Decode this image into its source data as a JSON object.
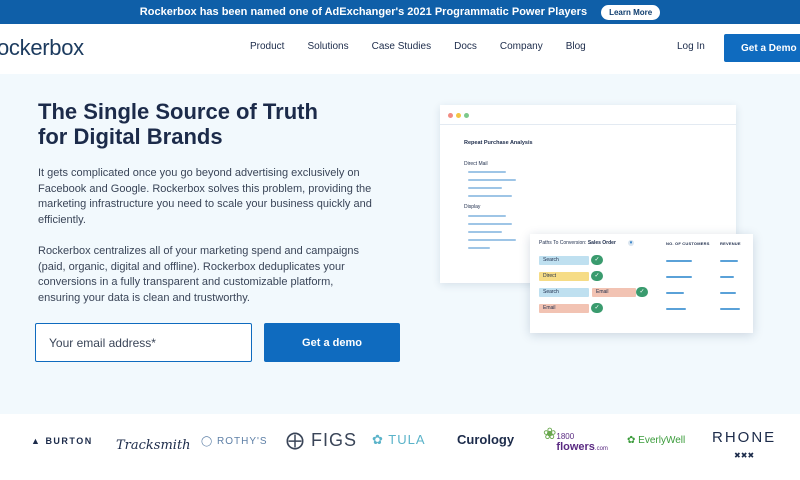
{
  "announcement": {
    "text": "Rockerbox has been named one of AdExchanger's 2021 Programmatic Power Players",
    "button": "Learn More"
  },
  "nav": {
    "logo": "ockerbox",
    "links": [
      "Product",
      "Solutions",
      "Case Studies",
      "Docs",
      "Company",
      "Blog"
    ],
    "login": "Log In",
    "cta": "Get a Demo"
  },
  "hero": {
    "headline_line1": "The Single Source of Truth",
    "headline_line2": "for Digital Brands",
    "paragraph1": "It gets complicated once you go beyond advertising exclusively on Facebook and Google. Rockerbox solves this problem, providing the marketing infrastructure you need to scale your business quickly and efficiently.",
    "paragraph2": "Rockerbox centralizes all of your marketing spend and campaigns (paid, organic, digital and offline). Rockerbox deduplicates your conversions in a fully transparent and customizable platform, ensuring your data is clean and trustworthy.",
    "email_placeholder": "Your email address*",
    "cta": "Get a demo"
  },
  "mockup": {
    "title": "Repeat Purchase Analysis",
    "label_direct_mail": "Direct Mail",
    "label_display": "Display",
    "panel": {
      "heading_prefix": "Paths To Conversion:",
      "heading_value": "Sales Order",
      "col_customers": "NO. OF CUSTOMERS",
      "col_revenue": "REVENUE",
      "rows": [
        {
          "chips": [
            "Search"
          ]
        },
        {
          "chips": [
            "Direct"
          ]
        },
        {
          "chips": [
            "Search",
            "Email"
          ]
        },
        {
          "chips": [
            "Email"
          ]
        }
      ]
    },
    "colors": {
      "dot_red": "#f28b82",
      "dot_yellow": "#f4c542",
      "dot_green": "#7cc98b",
      "chip_search": "#bfe0f0",
      "chip_direct": "#f6dc86",
      "chip_email": "#f2c3b3",
      "check": "#3a9b6e"
    }
  },
  "logos": {
    "burton": "BURTON",
    "tracksmith": "Tracksmith",
    "rothys": "ROTHY'S",
    "figs": "FIGS",
    "tula": "TULA",
    "curology": "Curology",
    "flowers_number": "1800",
    "flowers_word": "flowers",
    "flowers_suffix": ".com",
    "everlywell": "EverlyWell",
    "rhone": "RHONE"
  },
  "colors": {
    "brand_blue": "#0f6bbf",
    "announce_bg": "#0f5fa8",
    "hero_bg": "#f2f9fd",
    "text_dark": "#1c2b4a"
  }
}
